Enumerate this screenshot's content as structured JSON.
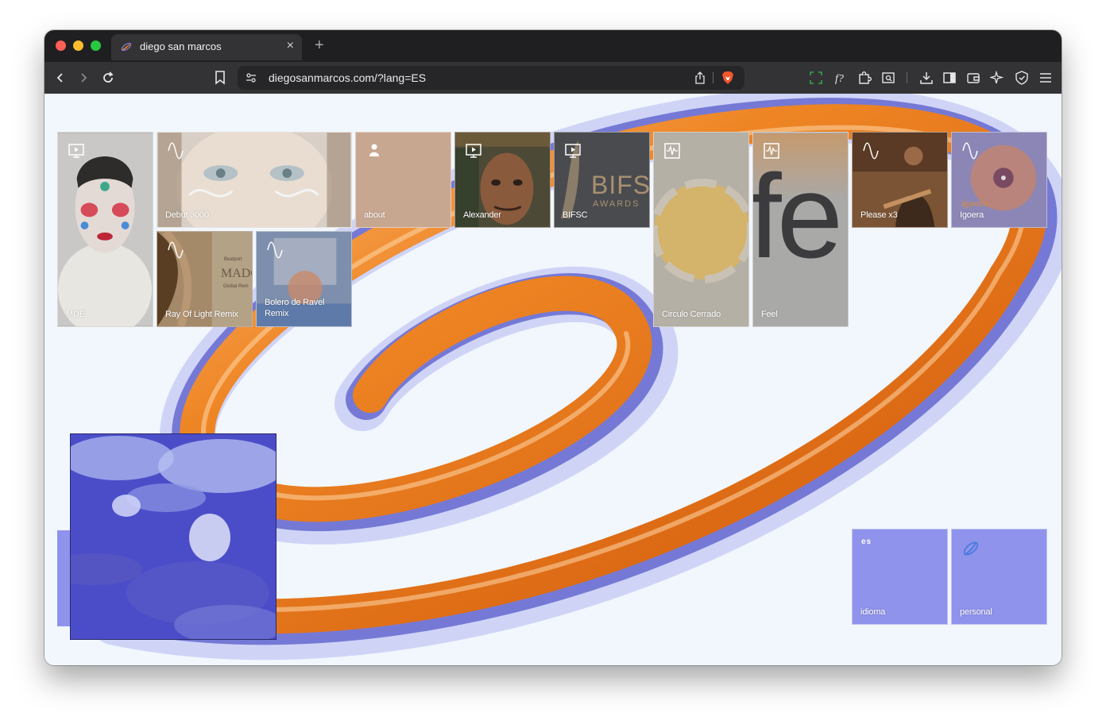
{
  "browser": {
    "tab_title": "diego san marcos",
    "new_tab": "+",
    "close": "×",
    "url": "diegosanmarcos.com/?lang=ES"
  },
  "tiles": {
    "mde": "MDE",
    "debut": "Debut 3000",
    "about": "about",
    "alexander": "Alexander",
    "bifsc": "BIFSC",
    "bifs_logo": "BIFS",
    "awards": "AWARDS",
    "circulo": "Circulo Cerrado",
    "circulo_art": "circulo cerrado",
    "feel": "Feel",
    "fe": "fe",
    "please": "Please x3",
    "igoera": "Igoera",
    "igoera_art": "igoera",
    "ray": "Ray Of Light Remix",
    "madonna": "MADO",
    "global": "Global Rem",
    "beatport": "Beatport",
    "bolero": "Bolero de Ravel Remix",
    "idioma": "idioma",
    "lang_code": "es",
    "personal": "personal"
  },
  "colors": {
    "orange": "#e67a1e",
    "periwinkle": "#8f93ec",
    "bg": "#f1f7fd"
  },
  "icons": [
    "back-icon",
    "forward-icon",
    "reload-icon",
    "bookmark-icon",
    "site-settings-icon",
    "share-icon",
    "brave-shield-icon",
    "screenshot-icon",
    "font-icon",
    "extensions-icon",
    "reader-icon",
    "download-icon",
    "sidebar-icon",
    "wallet-icon",
    "leo-icon",
    "vpn-icon",
    "menu-icon"
  ]
}
